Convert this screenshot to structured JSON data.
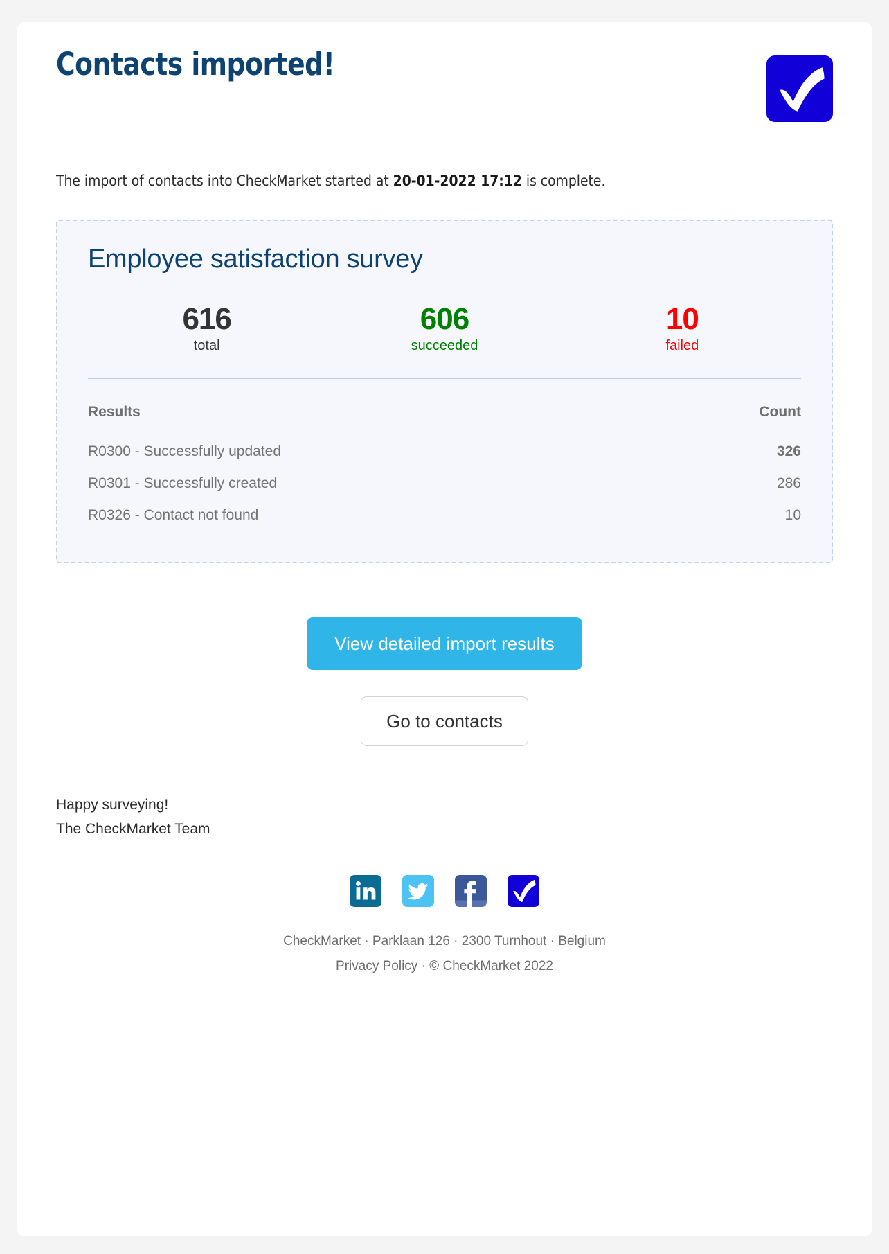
{
  "header": {
    "title": "Contacts imported!",
    "logo_icon": "checkmarket-logo-icon",
    "logo_color": "#1200d8"
  },
  "intro": {
    "before": "The import of contacts into CheckMarket started at ",
    "datetime": "20-01-2022 17:12",
    "after": " is complete."
  },
  "panel": {
    "survey_name": "Employee satisfaction survey",
    "stats": [
      {
        "value": "616",
        "label": "total",
        "color": "#343434"
      },
      {
        "value": "606",
        "label": "succeeded",
        "color": "#008000"
      },
      {
        "value": "10",
        "label": "failed",
        "color": "#ff0000"
      }
    ],
    "table": {
      "columns": [
        "Results",
        "Count"
      ],
      "rows": [
        {
          "result": "R0300 - Successfully updated",
          "count": "326"
        },
        {
          "result": "R0301 - Successfully created",
          "count": "286"
        },
        {
          "result": "R0326 - Contact not found",
          "count": "10"
        }
      ]
    }
  },
  "actions": {
    "primary_label": "View detailed import results",
    "primary_color": "#2fb5e8",
    "secondary_label": "Go to contacts"
  },
  "signoff": {
    "line1": "Happy surveying!",
    "line2": "The CheckMarket Team"
  },
  "social": [
    {
      "name": "linkedin-icon",
      "label": "LinkedIn",
      "color": "#0a6c92"
    },
    {
      "name": "twitter-icon",
      "label": "Twitter",
      "color": "#4cc3f2"
    },
    {
      "name": "facebook-icon",
      "label": "Facebook",
      "color": "#3b5998"
    },
    {
      "name": "checkmarket-icon",
      "label": "CheckMarket",
      "color": "#1200d8"
    }
  ],
  "footer": {
    "address": "CheckMarket · Parklaan 126 · 2300 Turnhout · Belgium",
    "privacy_label": "Privacy Policy",
    "separator": " · © ",
    "company_label": "CheckMarket",
    "year": " 2022"
  }
}
